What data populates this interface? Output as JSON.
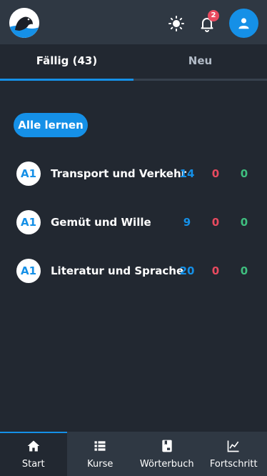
{
  "header": {
    "logo_icon": "seal-logo-icon",
    "theme_icon": "sun-icon",
    "notification_icon": "bell-icon",
    "notification_count": "2",
    "profile_icon": "user-icon"
  },
  "tabs": [
    {
      "label": "Fällig (43)",
      "active": true
    },
    {
      "label": "Neu",
      "active": false
    }
  ],
  "learn_all_label": "Alle lernen",
  "courses": [
    {
      "level": "A1",
      "title": "Transport und Verkehr",
      "counts": [
        "14",
        "0",
        "0"
      ]
    },
    {
      "level": "A1",
      "title": "Gemüt und Wille",
      "counts": [
        "9",
        "0",
        "0"
      ]
    },
    {
      "level": "A1",
      "title": "Literatur und Sprache",
      "counts": [
        "20",
        "0",
        "0"
      ]
    }
  ],
  "bottom_nav": [
    {
      "label": "Start",
      "icon": "home-icon",
      "active": true
    },
    {
      "label": "Kurse",
      "icon": "list-icon",
      "active": false
    },
    {
      "label": "Wörterbuch",
      "icon": "dictionary-icon",
      "active": false
    },
    {
      "label": "Fortschritt",
      "icon": "chart-line-icon",
      "active": false
    }
  ],
  "colors": {
    "background": "#222831",
    "bar": "#2f3843",
    "accent": "#1590e7",
    "red": "#e84a5f",
    "green": "#3fbf7f"
  }
}
